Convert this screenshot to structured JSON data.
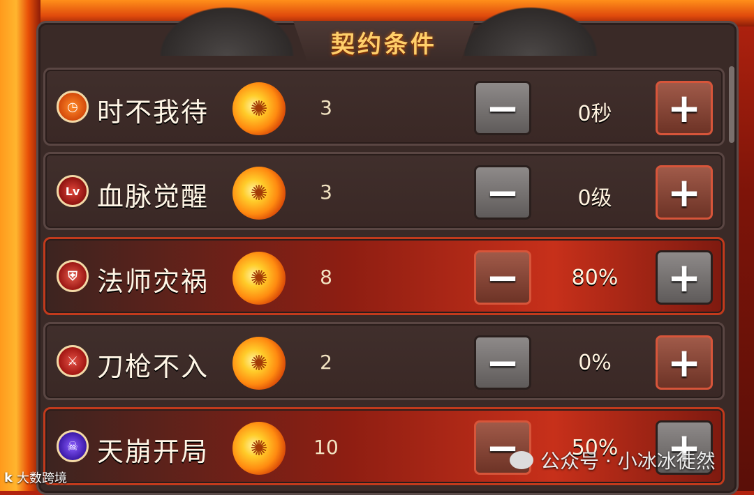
{
  "panel": {
    "title": "契约条件"
  },
  "conditions": [
    {
      "name": "时不我待",
      "icon": "clock-icon",
      "points": "3",
      "value": "0秒",
      "active": false,
      "minus_style": "gray",
      "plus_style": "red"
    },
    {
      "name": "血脉觉醒",
      "icon_text": "Lv",
      "icon": "level-icon",
      "points": "3",
      "value": "0级",
      "active": false,
      "minus_style": "gray",
      "plus_style": "red"
    },
    {
      "name": "法师灾祸",
      "icon": "shield-icon",
      "points": "8",
      "value": "80%",
      "active": true,
      "minus_style": "red",
      "plus_style": "gray"
    },
    {
      "name": "刀枪不入",
      "icon": "sword-shield-icon",
      "points": "2",
      "value": "0%",
      "active": false,
      "minus_style": "gray",
      "plus_style": "red"
    },
    {
      "name": "天崩开局",
      "icon": "skull-icon",
      "points": "10",
      "value": "50%",
      "active": true,
      "minus_style": "red",
      "plus_style": "gray"
    }
  ],
  "buttons": {
    "minus": "−",
    "plus": "+"
  },
  "watermarks": {
    "left": "大数跨境",
    "left_logo": "k",
    "right": "公众号 · 小冰冰徒然"
  },
  "colors": {
    "active_row": "#c7301a",
    "inactive_row": "#3a2825",
    "title": "#ffcf6a"
  }
}
